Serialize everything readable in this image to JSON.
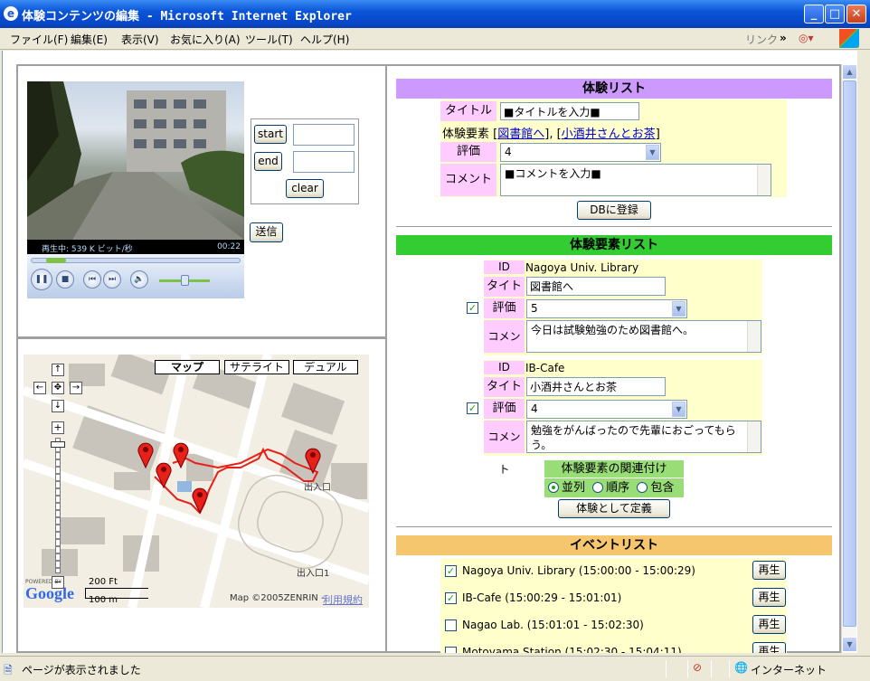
{
  "window": {
    "title": "体験コンテンツの編集 - Microsoft Internet Explorer"
  },
  "menu": {
    "items": [
      "ファイル(F)",
      "編集(E)",
      "表示(V)",
      "お気に入り(A)",
      "ツール(T)",
      "ヘルプ(H)"
    ],
    "links_label": "リンク",
    "chevron": "»"
  },
  "player": {
    "status_text": "再生中: 539 K ビット/秒",
    "time": "00:22",
    "start_label": "start",
    "end_label": "end",
    "clear_label": "clear",
    "send_label": "送信",
    "start_value": "",
    "end_value": ""
  },
  "map": {
    "tabs": [
      "マップ",
      "サテライト",
      "デュアル"
    ],
    "scale_ft": "200 Ft",
    "scale_m": "100 m",
    "copyright": "Map ©2005ZENRIN -",
    "terms_link": "利用規約",
    "label_exit1": "出入口",
    "label_exit2": "出入口1",
    "brand": "Google",
    "powered": "POWERED BY"
  },
  "experience_list": {
    "header": "体験リスト",
    "title_label": "タイトル",
    "title_value": "■タイトルを入力■",
    "elements_label": "体験要素",
    "elements_open": "[",
    "element_link_1": "図書館へ",
    "elements_mid": "], [",
    "element_link_2": "小酒井さんとお茶",
    "elements_close": "]",
    "rating_label": "評価",
    "rating_value": "4",
    "comment_label": "コメント",
    "comment_value": "■コメントを入力■",
    "register_button": "DBに登録"
  },
  "element_list": {
    "header": "体験要素リスト",
    "id_label": "ID",
    "title_label": "タイトル",
    "rating_label": "評価",
    "comment_label": "コメント",
    "items": [
      {
        "id": "Nagoya Univ. Library",
        "title": "図書館へ",
        "rating": "5",
        "comment": "今日は試験勉強のため図書館へ。",
        "checked": true
      },
      {
        "id": "IB-Cafe",
        "title": "小酒井さんとお茶",
        "rating": "4",
        "comment": "勉強をがんばったので先輩におごってもらう。",
        "checked": true
      }
    ],
    "relation_title": "体験要素の関連付け",
    "relations": [
      "並列",
      "順序",
      "包含"
    ],
    "relation_selected": "並列",
    "define_button": "体験として定義"
  },
  "event_list": {
    "header": "イベントリスト",
    "play_label": "再生",
    "events": [
      {
        "label": "Nagoya Univ. Library (15:00:00 - 15:00:29)",
        "checked": true
      },
      {
        "label": "IB-Cafe (15:00:29 - 15:01:01)",
        "checked": true
      },
      {
        "label": "Nagao Lab. (15:01:01 - 15:02:30)",
        "checked": false
      },
      {
        "label": "Motoyama Station (15:02:30 - 15:04:11)",
        "checked": false
      }
    ]
  },
  "status": {
    "text": "ページが表示されました",
    "zone": "インターネット"
  },
  "colors": {
    "experience_header": "#cc99ff",
    "element_header": "#33cc33",
    "event_header": "#f5c66e",
    "label_bg": "#ffffcc",
    "label_bg_pink": "#ffccff",
    "relation_bg": "#99dd77",
    "marker": "#e8201a",
    "route": "#e8201a"
  }
}
